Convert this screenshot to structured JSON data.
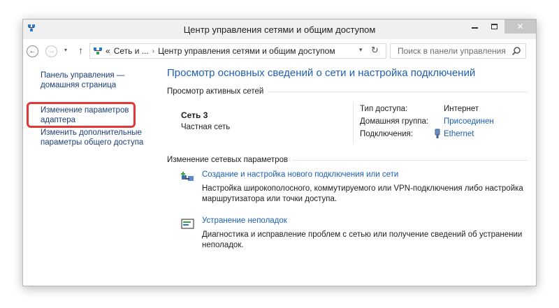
{
  "window": {
    "title": "Центр управления сетями и общим доступом",
    "close_glyph": "✕"
  },
  "nav": {
    "back_glyph": "←",
    "forward_glyph": "→",
    "dropdown_glyph": "▾",
    "up_glyph": "↑"
  },
  "address": {
    "prefix": "«",
    "crumb1": "Сеть и ...",
    "separator": "›",
    "crumb2": "Центр управления сетями и общим доступом",
    "dropdown_glyph": "▾",
    "refresh_glyph": "↻"
  },
  "search": {
    "placeholder": "Поиск в панели управления"
  },
  "sidebar": {
    "home_link": "Панель управления — домашняя страница",
    "adapter_link": "Изменение параметров адаптера",
    "sharing_link": "Изменить дополнительные параметры общего доступа"
  },
  "main": {
    "title": "Просмотр основных сведений о сети и настройка подключений",
    "active_networks_heading": "Просмотр активных сетей",
    "network": {
      "name": "Сеть 3",
      "type": "Частная сеть",
      "access_type_label": "Тип доступа:",
      "access_type_value": "Интернет",
      "homegroup_label": "Домашняя группа:",
      "homegroup_value": "Присоединен",
      "connections_label": "Подключения:",
      "connections_value": "Ethernet"
    },
    "change_settings_heading": "Изменение сетевых параметров",
    "tasks": [
      {
        "link": "Создание и настройка нового подключения или сети",
        "description": "Настройка широкополосного, коммутируемого или VPN-подключения либо настройка маршрутизатора или точки доступа."
      },
      {
        "link": "Устранение неполадок",
        "description": "Диагностика и исправление проблем с сетью или получение сведений об устранении неполадок."
      }
    ]
  },
  "colors": {
    "link": "#1a5fb4",
    "title_blue": "#1e5fb3",
    "highlight": "#e33636",
    "close_button": "#c7c7c7"
  },
  "icons": {
    "app": "network-center-icon",
    "search": "search-icon",
    "ethernet": "ethernet-icon",
    "new_connection": "new-connection-icon",
    "troubleshoot": "troubleshoot-icon"
  }
}
